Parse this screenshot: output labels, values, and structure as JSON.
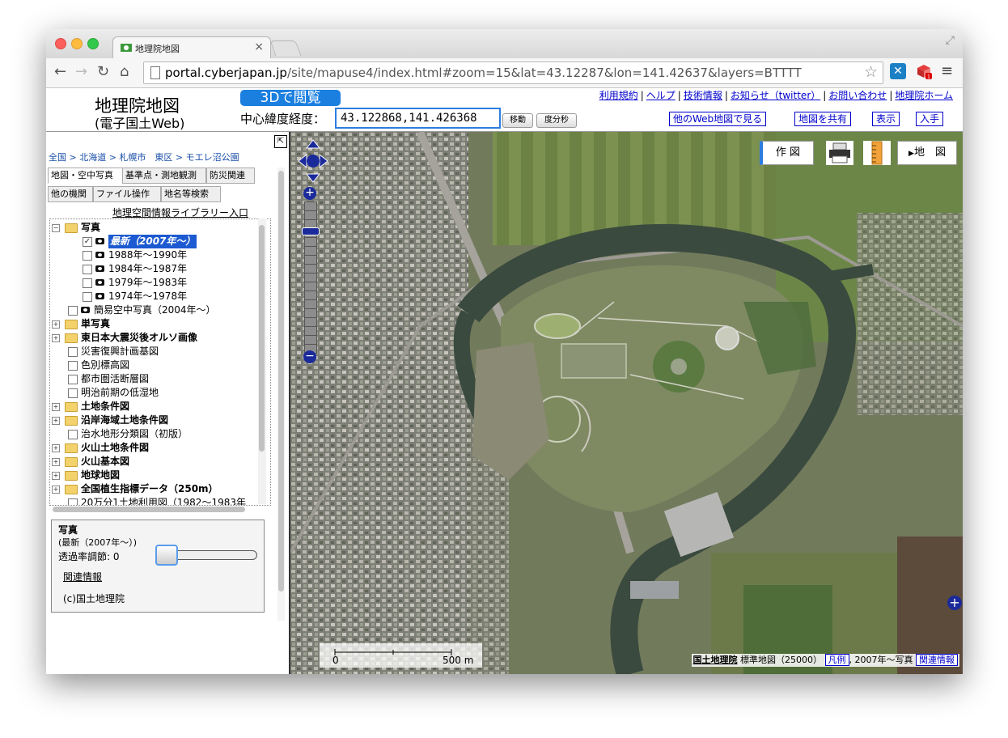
{
  "browser": {
    "tab_title": "地理院地図",
    "url_host": "portal.cyberjapan.jp",
    "url_path": "/site/mapuse4/index.html#zoom=15&lat=43.12287&lon=141.42637&layers=BTTTT"
  },
  "header": {
    "logo_line1": "地理院地図",
    "logo_line2": "(電子国土Web)",
    "btn_3d": "3Dで閲覧",
    "center_label": "中心緯度経度：",
    "coord_value": "43.122868,141.426368",
    "move_btn": "移動",
    "dms_btn": "度分秒",
    "links": [
      "利用規約",
      "ヘルプ",
      "技術情報",
      "お知らせ（twitter）",
      "お問い合わせ",
      "地理院ホーム"
    ],
    "buttons": [
      "他のWeb地図で見る",
      "地図を共有",
      "表示",
      "入手"
    ]
  },
  "left": {
    "breadcrumb": "全国 > 北海道 > 札幌市　東区 > モエレ沼公園",
    "tabs_row1": [
      "地図・空中写真",
      "基準点・測地観測",
      "防災関連"
    ],
    "tabs_row2": [
      "他の機関",
      "ファイル操作",
      "地名等検索"
    ],
    "library_link": "地理空間情報ライブラリー入口",
    "tree": [
      {
        "label": "写真",
        "level": 0,
        "expander": "⊟",
        "folder": true,
        "bold": true
      },
      {
        "label": "最新（2007年〜）",
        "level": 1,
        "check": true,
        "cam": true,
        "selected": true
      },
      {
        "label": "1988年〜1990年",
        "level": 1,
        "check": false,
        "cam": true
      },
      {
        "label": "1984年〜1987年",
        "level": 1,
        "check": false,
        "cam": true
      },
      {
        "label": "1979年〜1983年",
        "level": 1,
        "check": false,
        "cam": true
      },
      {
        "label": "1974年〜1978年",
        "level": 1,
        "check": false,
        "cam": true
      },
      {
        "label": "簡易空中写真（2004年〜）",
        "level": 0.5,
        "check": false,
        "cam": true
      },
      {
        "label": "単写真",
        "level": 0,
        "expander": "⊞",
        "folder": true,
        "bold": true
      },
      {
        "label": "東日本大震災後オルソ画像",
        "level": 0,
        "expander": "⊞",
        "folder": true,
        "bold": true
      },
      {
        "label": "災害復興計画基図",
        "level": 0.5,
        "check": false
      },
      {
        "label": "色別標高図",
        "level": 0.5,
        "check": false
      },
      {
        "label": "都市圏活断層図",
        "level": 0.5,
        "check": false
      },
      {
        "label": "明治前期の低湿地",
        "level": 0.5,
        "check": false
      },
      {
        "label": "土地条件図",
        "level": 0,
        "expander": "⊞",
        "folder": true,
        "bold": true
      },
      {
        "label": "沿岸海域土地条件図",
        "level": 0,
        "expander": "⊞",
        "folder": true,
        "bold": true
      },
      {
        "label": "治水地形分類図（初版）",
        "level": 0.5,
        "check": false
      },
      {
        "label": "火山土地条件図",
        "level": 0,
        "expander": "⊞",
        "folder": true,
        "bold": true
      },
      {
        "label": "火山基本図",
        "level": 0,
        "expander": "⊞",
        "folder": true,
        "bold": true
      },
      {
        "label": "地球地図",
        "level": 0,
        "expander": "⊞",
        "folder": true,
        "bold": true
      },
      {
        "label": "全国植生指標データ（250m）",
        "level": 0,
        "expander": "⊞",
        "folder": true,
        "bold": true
      },
      {
        "label": "20万分1土地利用図（1982〜1983年",
        "level": 0.5,
        "check": false
      }
    ],
    "info": {
      "title": "写真",
      "subtitle": "(最新（2007年〜）)",
      "transparency_label": "透過率調節: 0",
      "related": "関連情報",
      "credit": "(c)国土地理院"
    }
  },
  "map": {
    "tool_draw": "作 図",
    "tool_map": "地　図",
    "scale_left": "0",
    "scale_right": "500 m",
    "attrib_org": "国土地理院",
    "attrib_map": "標準地図（25000）",
    "attrib_legend": "凡例",
    "attrib_photo": ", 2007年〜写真",
    "attrib_related": "関連情報"
  }
}
